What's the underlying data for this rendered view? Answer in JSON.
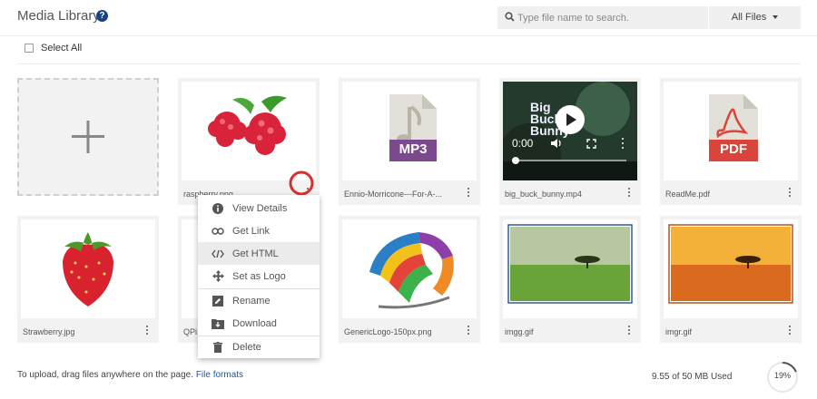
{
  "header": {
    "title": "Media Library",
    "help": "?"
  },
  "search": {
    "placeholder": "Type file name to search."
  },
  "filter": {
    "label": "All Files"
  },
  "select_all": "Select All",
  "files": [
    {
      "name": "raspberry.png"
    },
    {
      "name": "Ennio-Morricone---For-A-..."
    },
    {
      "name": "big_buck_bunny.mp4",
      "player_time": "0:00",
      "poster_text": "Big Buck Bunny"
    },
    {
      "name": "ReadMe.pdf"
    },
    {
      "name": "Strawberry.jpg"
    },
    {
      "name": "QPi..."
    },
    {
      "name": "GenericLogo-150px.png"
    },
    {
      "name": "imgg.gif"
    },
    {
      "name": "imgr.gif"
    }
  ],
  "badges": {
    "mp3": "MP3",
    "pdf": "PDF"
  },
  "context_menu": {
    "items": [
      "View Details",
      "Get Link",
      "Get HTML",
      "Set as Logo",
      "Rename",
      "Download",
      "Delete"
    ],
    "highlighted": "Get HTML"
  },
  "footer": {
    "upload_hint": "To upload, drag files anywhere on the page.",
    "formats_link": "File formats",
    "storage_used": "9.55 of 50 MB Used",
    "storage_percent_label": "19%",
    "storage_fraction": 0.19
  },
  "colors": {
    "brand": "#17437f",
    "highlight_ring": "#d9302c",
    "link": "#1a5aa8",
    "mp3": "#7b4a8e",
    "pdf": "#d9453a"
  }
}
